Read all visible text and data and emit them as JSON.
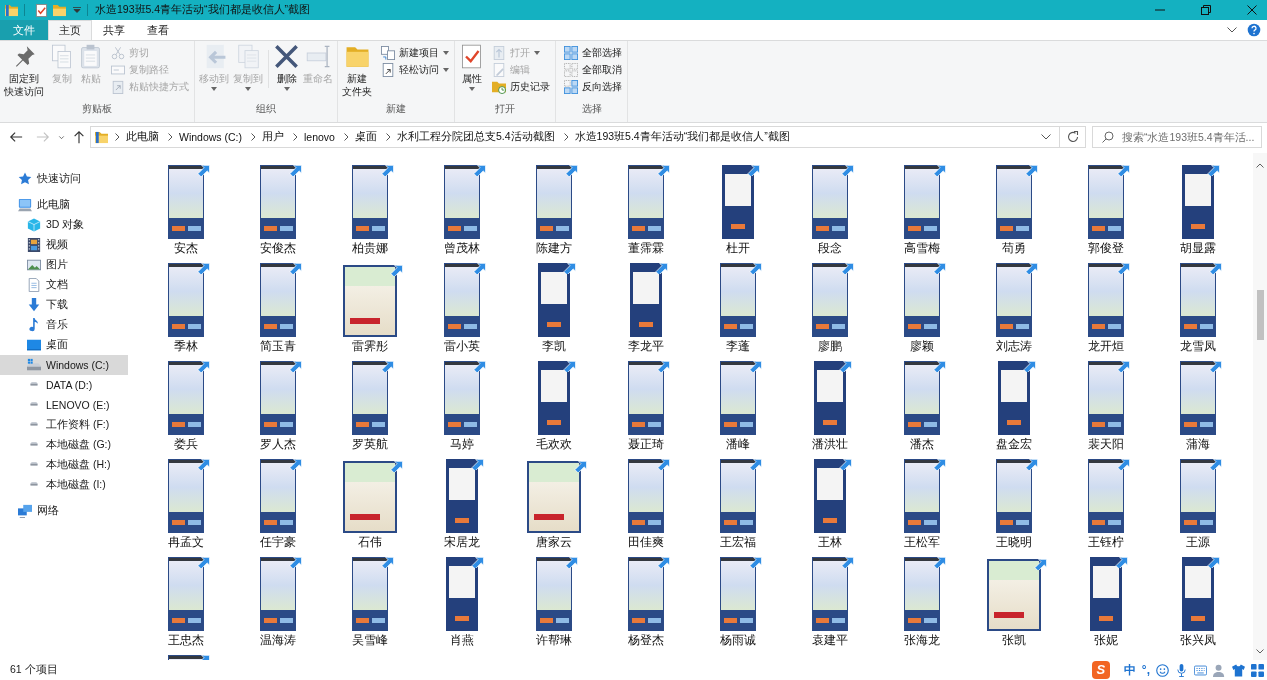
{
  "window": {
    "title": "水造193班5.4青年活动“我们都是收信人”截图"
  },
  "ribbon_tabs": [
    {
      "label": "文件",
      "kind": "file",
      "selected": false
    },
    {
      "label": "主页",
      "kind": "tab",
      "selected": true
    },
    {
      "label": "共享",
      "kind": "tab",
      "selected": false
    },
    {
      "label": "查看",
      "kind": "tab",
      "selected": false
    }
  ],
  "ribbon": {
    "groups": [
      {
        "label": "剪贴板",
        "sections": [
          {
            "large": [
              {
                "kind": "pin",
                "label": "固定到快速访问",
                "disabled": false,
                "menu": false
              },
              {
                "kind": "copy",
                "label": "复制",
                "disabled": true,
                "menu": false
              },
              {
                "kind": "paste",
                "label": "粘贴",
                "disabled": true,
                "menu": false
              }
            ],
            "small": [
              {
                "kind": "cut",
                "label": "剪切",
                "disabled": true,
                "menu": false
              },
              {
                "kind": "copypath",
                "label": "复制路径",
                "disabled": true,
                "menu": false
              },
              {
                "kind": "pasteshortcut",
                "label": "粘贴快捷方式",
                "disabled": true,
                "menu": false
              }
            ]
          }
        ]
      },
      {
        "label": "组织",
        "sections": [
          {
            "large": [
              {
                "kind": "move",
                "label": "移动到",
                "disabled": true,
                "menu": true
              },
              {
                "kind": "copyto",
                "label": "复制到",
                "disabled": true,
                "menu": true
              }
            ]
          },
          {
            "large": [
              {
                "kind": "delete",
                "label": "删除",
                "disabled": false,
                "menu": true
              },
              {
                "kind": "rename",
                "label": "重命名",
                "disabled": true,
                "menu": false
              }
            ]
          }
        ]
      },
      {
        "label": "新建",
        "sections": [
          {
            "large": [
              {
                "kind": "folder",
                "label": "新建文件夹",
                "disabled": false,
                "menu": false
              }
            ],
            "small": [
              {
                "kind": "newitem",
                "label": "新建项目",
                "disabled": false,
                "menu": true
              },
              {
                "kind": "easyaccess",
                "label": "轻松访问",
                "disabled": false,
                "menu": true
              }
            ]
          }
        ]
      },
      {
        "label": "打开",
        "sections": [
          {
            "large": [
              {
                "kind": "properties",
                "label": "属性",
                "disabled": false,
                "menu": true
              }
            ],
            "small": [
              {
                "kind": "open",
                "label": "打开",
                "disabled": true,
                "menu": true
              },
              {
                "kind": "edit",
                "label": "编辑",
                "disabled": true,
                "menu": false
              },
              {
                "kind": "history",
                "label": "历史记录",
                "disabled": false,
                "menu": false
              }
            ]
          }
        ]
      },
      {
        "label": "选择",
        "sections": [
          {
            "small": [
              {
                "kind": "selectall",
                "label": "全部选择",
                "disabled": false,
                "menu": false
              },
              {
                "kind": "selectnone",
                "label": "全部取消",
                "disabled": false,
                "menu": false
              },
              {
                "kind": "invert",
                "label": "反向选择",
                "disabled": false,
                "menu": false
              }
            ]
          }
        ]
      }
    ]
  },
  "nav_buttons": [
    {
      "kind": "back",
      "disabled": false
    },
    {
      "kind": "forward",
      "disabled": true
    },
    {
      "kind": "recent",
      "disabled": false
    },
    {
      "kind": "up",
      "disabled": false
    }
  ],
  "address": {
    "crumbs": [
      "此电脑",
      "Windows (C:)",
      "用户",
      "lenovo",
      "桌面",
      "水利工程分院团总支5.4活动截图",
      "水造193班5.4青年活动“我们都是收信人”截图"
    ]
  },
  "search": {
    "placeholder": "搜索“水造193班5.4青年活..."
  },
  "sidebar": {
    "items": [
      {
        "label": "快速访问",
        "kind": "star",
        "selected": false
      },
      {
        "label": "此电脑",
        "kind": "computer",
        "selected": false,
        "children": [
          {
            "label": "3D 对象",
            "kind": "cube",
            "selected": false
          },
          {
            "label": "视频",
            "kind": "video",
            "selected": false
          },
          {
            "label": "图片",
            "kind": "pictures",
            "selected": false
          },
          {
            "label": "文档",
            "kind": "documents",
            "selected": false
          },
          {
            "label": "下载",
            "kind": "downloads",
            "selected": false
          },
          {
            "label": "音乐",
            "kind": "music",
            "selected": false
          },
          {
            "label": "桌面",
            "kind": "desktop",
            "selected": false
          },
          {
            "label": "Windows (C:)",
            "kind": "system-drive",
            "selected": true
          },
          {
            "label": "DATA (D:)",
            "kind": "drive",
            "selected": false
          },
          {
            "label": "LENOVO (E:)",
            "kind": "drive",
            "selected": false
          },
          {
            "label": "工作资料 (F:)",
            "kind": "drive",
            "selected": false
          },
          {
            "label": "本地磁盘 (G:)",
            "kind": "drive",
            "selected": false
          },
          {
            "label": "本地磁盘 (H:)",
            "kind": "drive",
            "selected": false
          },
          {
            "label": "本地磁盘 (I:)",
            "kind": "drive",
            "selected": false
          }
        ]
      },
      {
        "label": "网络",
        "kind": "network",
        "selected": false
      }
    ]
  },
  "files": [
    {
      "name": "安杰",
      "kind": "phone"
    },
    {
      "name": "安俊杰",
      "kind": "phone"
    },
    {
      "name": "柏贵娜",
      "kind": "phone"
    },
    {
      "name": "曾茂林",
      "kind": "phone"
    },
    {
      "name": "陈建方",
      "kind": "phone"
    },
    {
      "name": "董霈霖",
      "kind": "phone"
    },
    {
      "name": "杜开",
      "kind": "letter"
    },
    {
      "name": "段念",
      "kind": "phone"
    },
    {
      "name": "高雪梅",
      "kind": "phone"
    },
    {
      "name": "苟勇",
      "kind": "phone"
    },
    {
      "name": "郭俊登",
      "kind": "phone"
    },
    {
      "name": "胡显露",
      "kind": "letter"
    },
    {
      "name": "季林",
      "kind": "phone"
    },
    {
      "name": "简玉青",
      "kind": "phone"
    },
    {
      "name": "雷霁彤",
      "kind": "poster"
    },
    {
      "name": "雷小英",
      "kind": "phone"
    },
    {
      "name": "李凯",
      "kind": "letter"
    },
    {
      "name": "李龙平",
      "kind": "letter"
    },
    {
      "name": "李蓬",
      "kind": "phone"
    },
    {
      "name": "廖鹏",
      "kind": "phone"
    },
    {
      "name": "廖颖",
      "kind": "phone"
    },
    {
      "name": "刘志涛",
      "kind": "phone"
    },
    {
      "name": "龙开烜",
      "kind": "phone"
    },
    {
      "name": "龙雪凤",
      "kind": "phone"
    },
    {
      "name": "娄兵",
      "kind": "phone"
    },
    {
      "name": "罗人杰",
      "kind": "phone"
    },
    {
      "name": "罗英航",
      "kind": "phone"
    },
    {
      "name": "马婷",
      "kind": "phone"
    },
    {
      "name": "毛欢欢",
      "kind": "letter"
    },
    {
      "name": "聂正琦",
      "kind": "phone"
    },
    {
      "name": "潘峰",
      "kind": "phone"
    },
    {
      "name": "潘洪壮",
      "kind": "letter"
    },
    {
      "name": "潘杰",
      "kind": "phone"
    },
    {
      "name": "盘金宏",
      "kind": "letter"
    },
    {
      "name": "裴天阳",
      "kind": "phone"
    },
    {
      "name": "蒲海",
      "kind": "phone"
    },
    {
      "name": "冉孟文",
      "kind": "phone"
    },
    {
      "name": "任宇豪",
      "kind": "phone"
    },
    {
      "name": "石伟",
      "kind": "poster"
    },
    {
      "name": "宋居龙",
      "kind": "letter"
    },
    {
      "name": "唐家云",
      "kind": "poster"
    },
    {
      "name": "田佳爽",
      "kind": "phone"
    },
    {
      "name": "王宏福",
      "kind": "phone"
    },
    {
      "name": "王林",
      "kind": "letter"
    },
    {
      "name": "王松军",
      "kind": "phone"
    },
    {
      "name": "王晓明",
      "kind": "phone"
    },
    {
      "name": "王钰柠",
      "kind": "phone"
    },
    {
      "name": "王源",
      "kind": "phone"
    },
    {
      "name": "王忠杰",
      "kind": "phone"
    },
    {
      "name": "温海涛",
      "kind": "phone"
    },
    {
      "name": "吴雪峰",
      "kind": "phone"
    },
    {
      "name": "肖燕",
      "kind": "letter"
    },
    {
      "name": "许帮琳",
      "kind": "phone"
    },
    {
      "name": "杨登杰",
      "kind": "phone"
    },
    {
      "name": "杨雨诚",
      "kind": "phone"
    },
    {
      "name": "袁建平",
      "kind": "phone"
    },
    {
      "name": "张海龙",
      "kind": "phone"
    },
    {
      "name": "张凯",
      "kind": "poster"
    },
    {
      "name": "张妮",
      "kind": "letter"
    },
    {
      "name": "张兴凤",
      "kind": "letter"
    },
    {
      "kind": "phone"
    }
  ],
  "status_bar": {
    "item_count": "61 个项目"
  },
  "ime_bar": {
    "logo": "S",
    "mode": "中",
    "punctuation": "°,"
  }
}
